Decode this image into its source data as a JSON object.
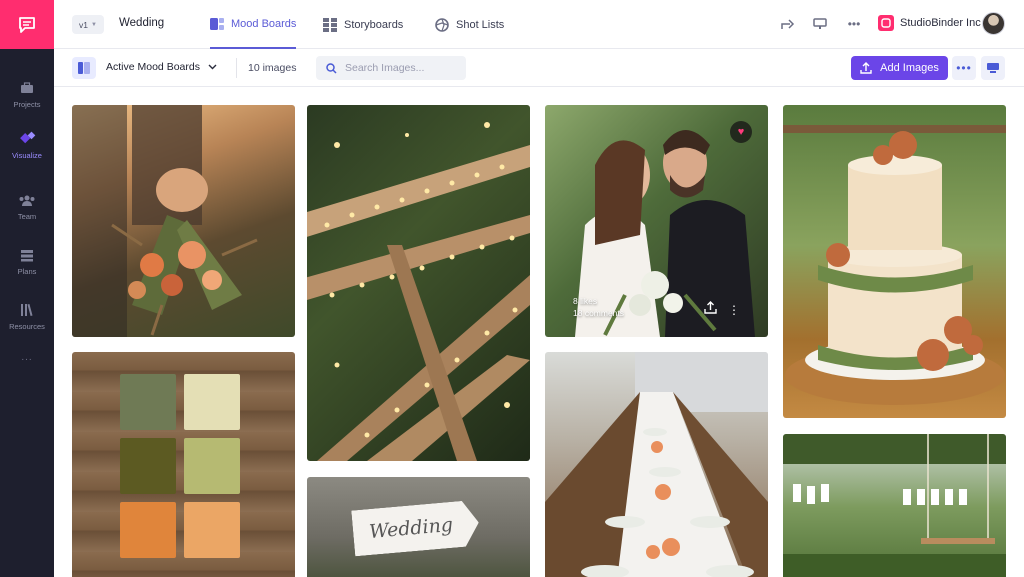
{
  "sidebar": {
    "logo": "chat-logo-icon",
    "items": [
      {
        "label": "Projects",
        "icon": "briefcase-icon"
      },
      {
        "label": "Visualize",
        "icon": "visualize-icon",
        "active": true
      },
      {
        "label": "Team",
        "icon": "team-icon"
      },
      {
        "label": "Plans",
        "icon": "plans-icon"
      },
      {
        "label": "Resources",
        "icon": "resources-icon"
      }
    ],
    "more": "..."
  },
  "header": {
    "version": "v1",
    "project_name": "Wedding",
    "tabs": [
      {
        "label": "Mood Boards",
        "icon": "mood-boards-icon",
        "active": true
      },
      {
        "label": "Storyboards",
        "icon": "storyboards-icon"
      },
      {
        "label": "Shot Lists",
        "icon": "shot-lists-icon"
      }
    ],
    "company": "StudioBinder Inc"
  },
  "toolbar": {
    "board_selector": "Active Mood Boards",
    "image_count": "10 images",
    "search_placeholder": "Search Images...",
    "add_button": "Add Images"
  },
  "board": {
    "featured_image": {
      "likes": "8 likes",
      "comments": "18 comments",
      "favorited": true
    },
    "sign_text": "Wedding",
    "palette_colors": [
      "#6f7a55",
      "#e4dfb5",
      "#5c5a22",
      "#b6ba72",
      "#e0853b",
      "#eba665"
    ]
  },
  "colors": {
    "brand": "#ff2d6f",
    "accent": "#5b5bd6",
    "primary_button": "#6b45e8",
    "sidebar": "#1e1f2e"
  }
}
